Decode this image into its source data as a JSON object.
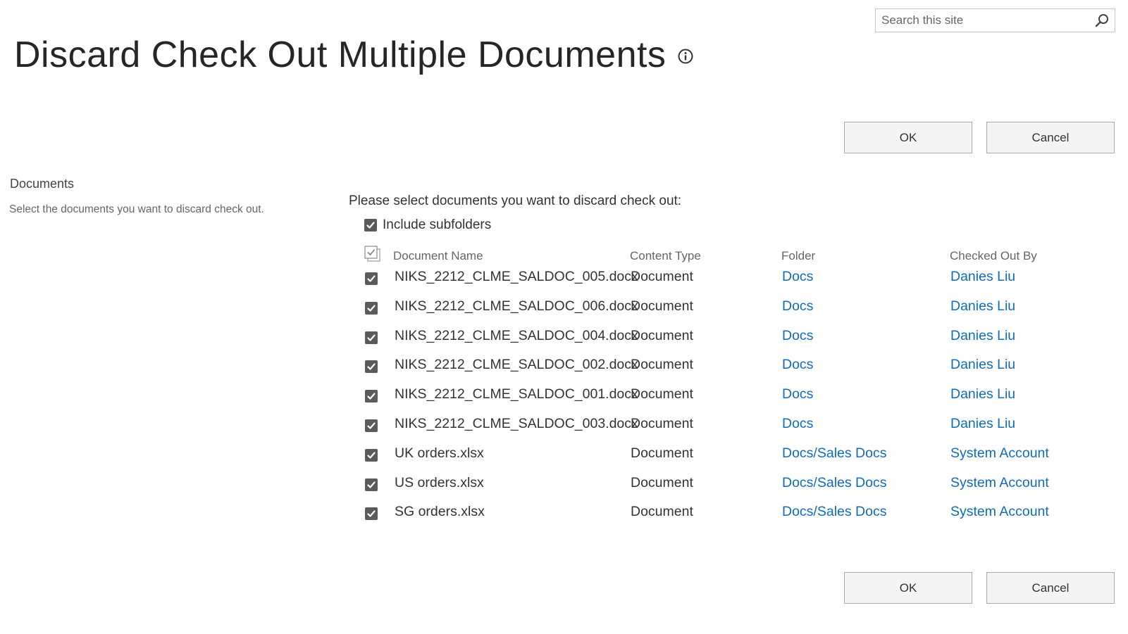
{
  "search": {
    "placeholder": "Search this site"
  },
  "page": {
    "title": "Discard Check Out Multiple Documents"
  },
  "buttons": {
    "ok": "OK",
    "cancel": "Cancel"
  },
  "section": {
    "title": "Documents",
    "description": "Select the documents you want to discard check out."
  },
  "form": {
    "prompt": "Please select documents you want to discard check out:",
    "include_subfolders_label": "Include subfolders",
    "include_subfolders_checked": true
  },
  "table": {
    "columns": [
      "Document Name",
      "Content Type",
      "Folder",
      "Checked Out By"
    ],
    "rows": [
      {
        "checked": true,
        "name": "NIKS_2212_CLME_SALDOC_005.docx",
        "type": "Document",
        "folder": "Docs",
        "user": "Danies Liu"
      },
      {
        "checked": true,
        "name": "NIKS_2212_CLME_SALDOC_006.docx",
        "type": "Document",
        "folder": "Docs",
        "user": "Danies Liu"
      },
      {
        "checked": true,
        "name": "NIKS_2212_CLME_SALDOC_004.docx",
        "type": "Document",
        "folder": "Docs",
        "user": "Danies Liu"
      },
      {
        "checked": true,
        "name": "NIKS_2212_CLME_SALDOC_002.docx",
        "type": "Document",
        "folder": "Docs",
        "user": "Danies Liu"
      },
      {
        "checked": true,
        "name": "NIKS_2212_CLME_SALDOC_001.docx",
        "type": "Document",
        "folder": "Docs",
        "user": "Danies Liu"
      },
      {
        "checked": true,
        "name": "NIKS_2212_CLME_SALDOC_003.docx",
        "type": "Document",
        "folder": "Docs",
        "user": "Danies Liu"
      },
      {
        "checked": true,
        "name": "UK orders.xlsx",
        "type": "Document",
        "folder": "Docs/Sales Docs",
        "user": "System Account"
      },
      {
        "checked": true,
        "name": "US orders.xlsx",
        "type": "Document",
        "folder": "Docs/Sales Docs",
        "user": "System Account"
      },
      {
        "checked": true,
        "name": "SG orders.xlsx",
        "type": "Document",
        "folder": "Docs/Sales Docs",
        "user": "System Account"
      }
    ]
  },
  "colors": {
    "link": "#0f6cbd",
    "checkbox": "#5b5b5b",
    "button_bg": "#f4f4f4",
    "button_border": "#ababab"
  },
  "icons": {
    "search": "search-icon",
    "info": "info-icon",
    "select_all": "select-all-icon",
    "check": "checkmark-icon"
  }
}
